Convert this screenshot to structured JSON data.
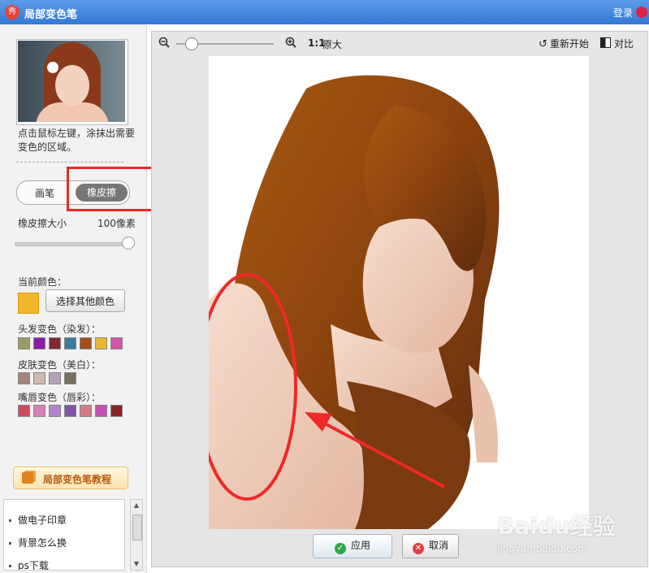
{
  "window": {
    "title": "局部变色笔",
    "login": "登录",
    "app_icon": "秀"
  },
  "sidebar": {
    "instruction": "点击鼠标左键，涂抹出需要变色的区域。",
    "mode_brush": "画笔",
    "mode_eraser": "橡皮擦",
    "active_mode": "橡皮擦",
    "size_label": "橡皮擦大小",
    "size_value": "100像素",
    "size_fraction": 1.0,
    "current_color_label": "当前颜色：",
    "current_color": "#f0b82a",
    "choose_color_button": "选择其他颜色",
    "hair_label": "头发变色（染发）：",
    "hair_colors": [
      "#9c9a64",
      "#8b1ea8",
      "#7e2a33",
      "#3a7ca0",
      "#a34d1e",
      "#eab830",
      "#d555a6"
    ],
    "skin_label": "皮肤变色（美白）：",
    "skin_colors": [
      "#a3877c",
      "#cdbdb0",
      "#b2a4b6",
      "#78705e"
    ],
    "lip_label": "嘴唇变色（唇彩）：",
    "lip_colors": [
      "#cf4a5a",
      "#d87fb7",
      "#b481cc",
      "#7f55a8",
      "#d27b88",
      "#c54fb2",
      "#8c2428"
    ],
    "tutorial_button": "局部变色笔教程",
    "list_items": [
      "做电子印章",
      "背景怎么换",
      "ps下载"
    ]
  },
  "toolbar": {
    "one_to_one": "1:1",
    "original_size": "原大",
    "restart": "重新开始",
    "compare": "对比",
    "zoom_fraction": 0.1
  },
  "actions": {
    "apply": "应用",
    "cancel": "取消"
  },
  "watermark": {
    "brand": "Baidu经验",
    "url": "jingyan.baidu.com"
  },
  "annotation_color": "#f02828"
}
